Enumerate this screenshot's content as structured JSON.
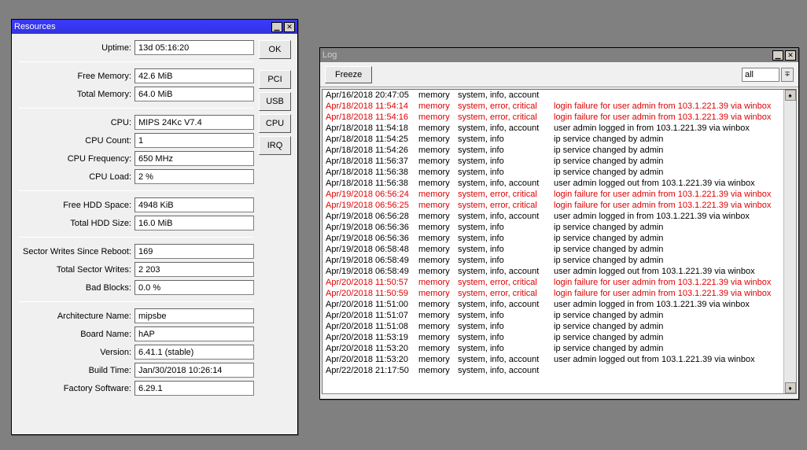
{
  "resources": {
    "title": "Resources",
    "groups": [
      [
        {
          "label": "Uptime:",
          "value": "13d 05:16:20"
        },
        {
          "label": "",
          "sep": true
        },
        {
          "label": "Free Memory:",
          "value": "42.6 MiB"
        },
        {
          "label": "Total Memory:",
          "value": "64.0 MiB"
        }
      ],
      [
        {
          "label": "CPU:",
          "value": "MIPS 24Kc V7.4"
        },
        {
          "label": "CPU Count:",
          "value": "1"
        },
        {
          "label": "CPU Frequency:",
          "value": "650 MHz"
        },
        {
          "label": "CPU Load:",
          "value": "2 %"
        }
      ],
      [
        {
          "label": "Free HDD Space:",
          "value": "4948 KiB"
        },
        {
          "label": "Total HDD Size:",
          "value": "16.0 MiB"
        }
      ],
      [
        {
          "label": "Sector Writes Since Reboot:",
          "value": "169"
        },
        {
          "label": "Total Sector Writes:",
          "value": "2 203"
        },
        {
          "label": "Bad Blocks:",
          "value": "0.0 %"
        }
      ],
      [
        {
          "label": "Architecture Name:",
          "value": "mipsbe"
        },
        {
          "label": "Board Name:",
          "value": "hAP"
        },
        {
          "label": "Version:",
          "value": "6.41.1 (stable)"
        },
        {
          "label": "Build Time:",
          "value": "Jan/30/2018 10:26:14"
        },
        {
          "label": "Factory Software:",
          "value": "6.29.1"
        }
      ]
    ],
    "buttons": {
      "ok": "OK",
      "pci": "PCI",
      "usb": "USB",
      "cpu": "CPU",
      "irq": "IRQ"
    }
  },
  "log": {
    "title": "Log",
    "freeze": "Freeze",
    "filter": "all",
    "entries": [
      {
        "ts": "Apr/16/2018 20:47:05",
        "buf": "memory",
        "topics": "system, info, account",
        "msg": "",
        "err": false
      },
      {
        "ts": "Apr/18/2018 11:54:14",
        "buf": "memory",
        "topics": "system, error, critical",
        "msg": "login failure for user admin from 103.1.221.39 via winbox",
        "err": true
      },
      {
        "ts": "Apr/18/2018 11:54:16",
        "buf": "memory",
        "topics": "system, error, critical",
        "msg": "login failure for user admin from 103.1.221.39 via winbox",
        "err": true
      },
      {
        "ts": "Apr/18/2018 11:54:18",
        "buf": "memory",
        "topics": "system, info, account",
        "msg": "user admin logged in from 103.1.221.39 via winbox",
        "err": false
      },
      {
        "ts": "Apr/18/2018 11:54:25",
        "buf": "memory",
        "topics": "system, info",
        "msg": "ip service changed by admin",
        "err": false
      },
      {
        "ts": "Apr/18/2018 11:54:26",
        "buf": "memory",
        "topics": "system, info",
        "msg": "ip service changed by admin",
        "err": false
      },
      {
        "ts": "Apr/18/2018 11:56:37",
        "buf": "memory",
        "topics": "system, info",
        "msg": "ip service changed by admin",
        "err": false
      },
      {
        "ts": "Apr/18/2018 11:56:38",
        "buf": "memory",
        "topics": "system, info",
        "msg": "ip service changed by admin",
        "err": false
      },
      {
        "ts": "Apr/18/2018 11:56:38",
        "buf": "memory",
        "topics": "system, info, account",
        "msg": "user admin logged out from 103.1.221.39 via winbox",
        "err": false
      },
      {
        "ts": "Apr/19/2018 06:56:24",
        "buf": "memory",
        "topics": "system, error, critical",
        "msg": "login failure for user admin from 103.1.221.39 via winbox",
        "err": true
      },
      {
        "ts": "Apr/19/2018 06:56:25",
        "buf": "memory",
        "topics": "system, error, critical",
        "msg": "login failure for user admin from 103.1.221.39 via winbox",
        "err": true
      },
      {
        "ts": "Apr/19/2018 06:56:28",
        "buf": "memory",
        "topics": "system, info, account",
        "msg": "user admin logged in from 103.1.221.39 via winbox",
        "err": false
      },
      {
        "ts": "Apr/19/2018 06:56:36",
        "buf": "memory",
        "topics": "system, info",
        "msg": "ip service changed by admin",
        "err": false
      },
      {
        "ts": "Apr/19/2018 06:56:36",
        "buf": "memory",
        "topics": "system, info",
        "msg": "ip service changed by admin",
        "err": false
      },
      {
        "ts": "Apr/19/2018 06:58:48",
        "buf": "memory",
        "topics": "system, info",
        "msg": "ip service changed by admin",
        "err": false
      },
      {
        "ts": "Apr/19/2018 06:58:49",
        "buf": "memory",
        "topics": "system, info",
        "msg": "ip service changed by admin",
        "err": false
      },
      {
        "ts": "Apr/19/2018 06:58:49",
        "buf": "memory",
        "topics": "system, info, account",
        "msg": "user admin logged out from 103.1.221.39 via winbox",
        "err": false
      },
      {
        "ts": "Apr/20/2018 11:50:57",
        "buf": "memory",
        "topics": "system, error, critical",
        "msg": "login failure for user admin from 103.1.221.39 via winbox",
        "err": true
      },
      {
        "ts": "Apr/20/2018 11:50:59",
        "buf": "memory",
        "topics": "system, error, critical",
        "msg": "login failure for user admin from 103.1.221.39 via winbox",
        "err": true
      },
      {
        "ts": "Apr/20/2018 11:51:00",
        "buf": "memory",
        "topics": "system, info, account",
        "msg": "user admin logged in from 103.1.221.39 via winbox",
        "err": false
      },
      {
        "ts": "Apr/20/2018 11:51:07",
        "buf": "memory",
        "topics": "system, info",
        "msg": "ip service changed by admin",
        "err": false
      },
      {
        "ts": "Apr/20/2018 11:51:08",
        "buf": "memory",
        "topics": "system, info",
        "msg": "ip service changed by admin",
        "err": false
      },
      {
        "ts": "Apr/20/2018 11:53:19",
        "buf": "memory",
        "topics": "system, info",
        "msg": "ip service changed by admin",
        "err": false
      },
      {
        "ts": "Apr/20/2018 11:53:20",
        "buf": "memory",
        "topics": "system, info",
        "msg": "ip service changed by admin",
        "err": false
      },
      {
        "ts": "Apr/20/2018 11:53:20",
        "buf": "memory",
        "topics": "system, info, account",
        "msg": "user admin logged out from 103.1.221.39 via winbox",
        "err": false
      },
      {
        "ts": "Apr/22/2018 21:17:50",
        "buf": "memory",
        "topics": "system, info, account",
        "msg": "",
        "err": false
      }
    ]
  }
}
